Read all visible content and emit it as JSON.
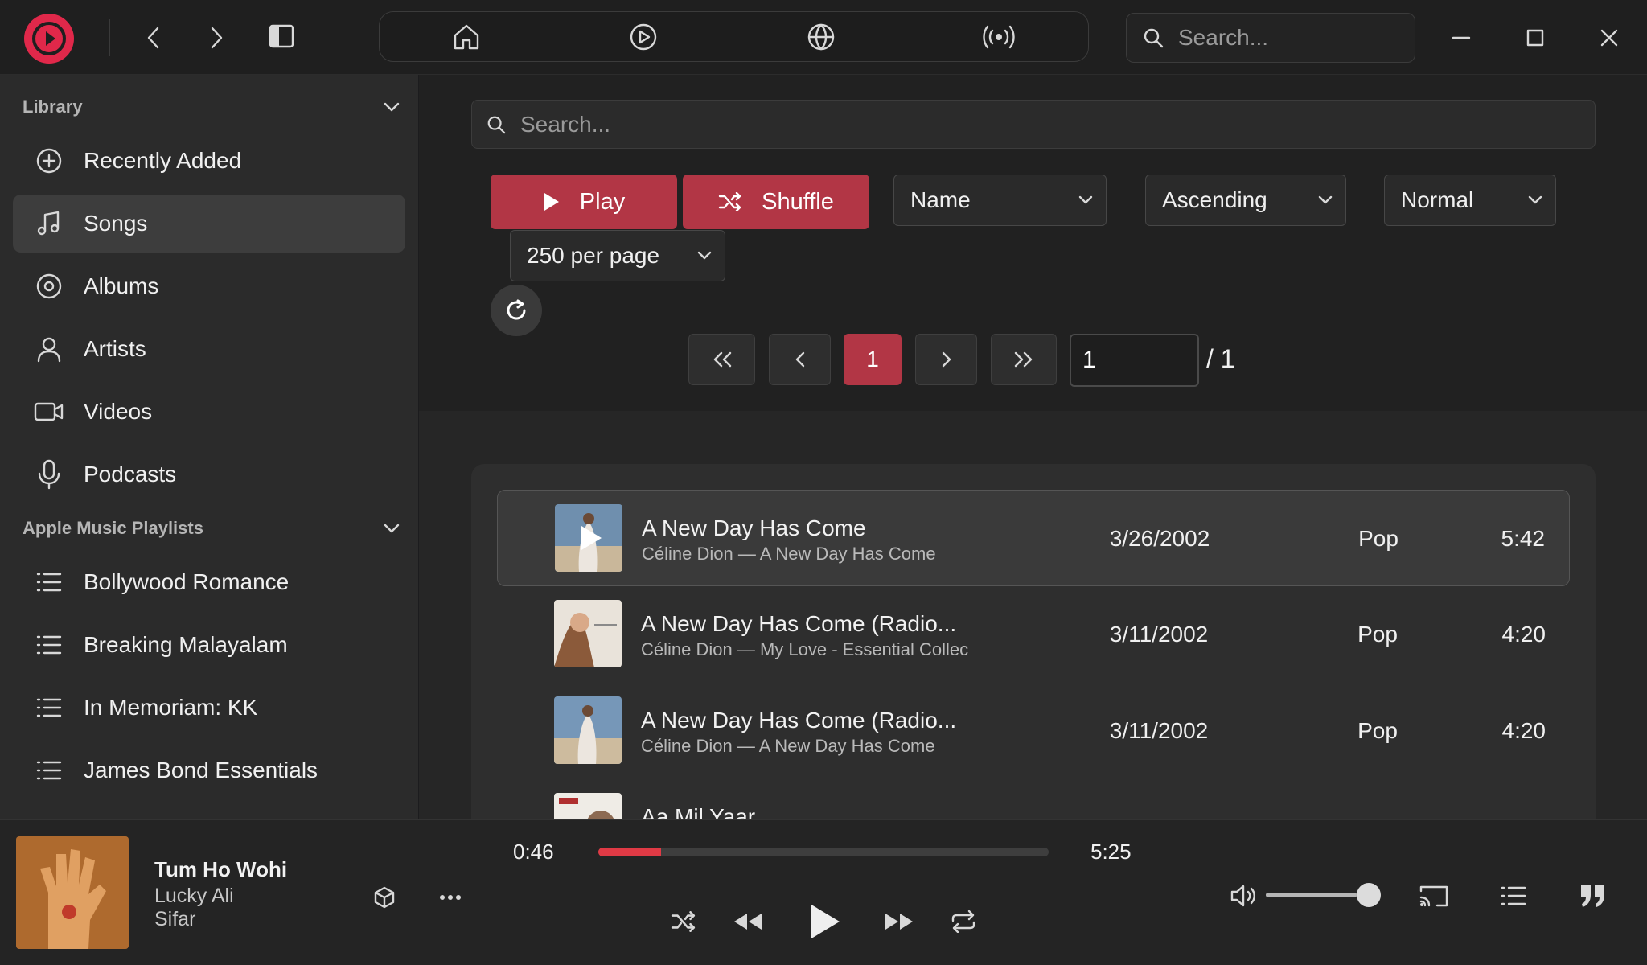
{
  "colors": {
    "accent": "#b23645",
    "brand": "#e0284a",
    "progress": "#e03a45"
  },
  "top_search": {
    "placeholder": "Search..."
  },
  "sidebar": {
    "library": {
      "title": "Library",
      "items": [
        {
          "label": "Recently Added",
          "icon": "plus-circle-icon"
        },
        {
          "label": "Songs",
          "icon": "music-note-icon",
          "active": true
        },
        {
          "label": "Albums",
          "icon": "album-disc-icon"
        },
        {
          "label": "Artists",
          "icon": "person-icon"
        },
        {
          "label": "Videos",
          "icon": "video-camera-icon"
        },
        {
          "label": "Podcasts",
          "icon": "microphone-icon"
        }
      ]
    },
    "apple_playlists": {
      "title": "Apple Music Playlists",
      "items": [
        {
          "label": "Bollywood Romance",
          "icon": "list-icon"
        },
        {
          "label": "Breaking Malayalam",
          "icon": "list-icon"
        },
        {
          "label": "In Memoriam: KK",
          "icon": "list-icon"
        },
        {
          "label": "James Bond Essentials",
          "icon": "list-icon"
        }
      ]
    }
  },
  "main": {
    "search_placeholder": "Search...",
    "play_label": "Play",
    "shuffle_label": "Shuffle",
    "sort_field": "Name",
    "sort_order": "Ascending",
    "view_mode": "Normal",
    "per_page": "250 per page",
    "pagination": {
      "current": "1",
      "input_value": "1",
      "total": "/ 1"
    }
  },
  "songs": [
    {
      "title": "A New Day Has Come",
      "subtitle": "Céline Dion — A New Day Has Come",
      "date": "3/26/2002",
      "genre": "Pop",
      "duration": "5:42"
    },
    {
      "title": "A New Day Has Come (Radio...",
      "subtitle": "Céline Dion — My Love - Essential Collec",
      "date": "3/11/2002",
      "genre": "Pop",
      "duration": "4:20"
    },
    {
      "title": "A New Day Has Come (Radio...",
      "subtitle": "Céline Dion — A New Day Has Come",
      "date": "3/11/2002",
      "genre": "Pop",
      "duration": "4:20"
    },
    {
      "title": "Aa Mil Yaar",
      "subtitle": "",
      "date": "",
      "genre": "",
      "duration": ""
    }
  ],
  "player": {
    "title": "Tum Ho Wohi",
    "artist": "Lucky Ali",
    "album": "Sifar",
    "elapsed": "0:46",
    "total": "5:25",
    "progress_fraction": 0.14,
    "volume_fraction": 0.88
  }
}
